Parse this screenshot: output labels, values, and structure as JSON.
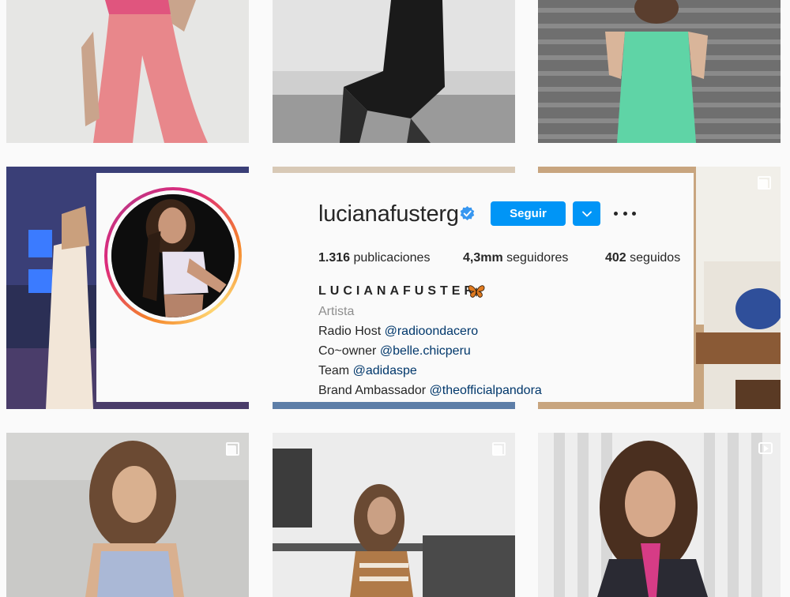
{
  "profile": {
    "username": "lucianafusterg",
    "follow_label": "Seguir",
    "icons": {
      "verified": "verified-badge-icon",
      "dropdown": "chevron-down-icon",
      "options": "more-horizontal-icon"
    },
    "stats": {
      "posts_count": "1.316",
      "posts_label": "publicaciones",
      "followers_count": "4,3mm",
      "followers_label": "seguidores",
      "following_count": "402",
      "following_label": "seguidos"
    },
    "full_name": "LUCIANAFUSTER",
    "full_name_emoji": "butterfly-emoji",
    "category": "Artista",
    "bio": [
      {
        "text": "Radio Host",
        "mention": "@radioondacero"
      },
      {
        "text": "Co~owner",
        "mention": "@belle.chicperu"
      },
      {
        "text": "Team",
        "mention": "@adidaspe"
      },
      {
        "text": "Brand Ambassador",
        "mention": "@theofficialpandora"
      }
    ]
  },
  "grid": {
    "post_type_icons": [
      "carousel-icon",
      "carousel-icon",
      "carousel-icon",
      "video-icon"
    ]
  },
  "colors": {
    "accent": "#0095f6",
    "mention": "#00376b",
    "text": "#262626",
    "muted": "#8e8e8e",
    "background": "#fafafa"
  }
}
